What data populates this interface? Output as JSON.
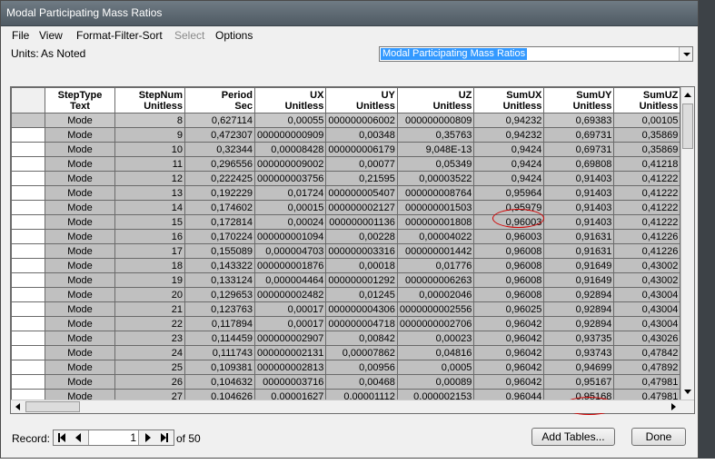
{
  "window": {
    "title": "Modal Participating Mass Ratios"
  },
  "menu": {
    "file": "File",
    "view": "View",
    "format": "Format-Filter-Sort",
    "select": "Select",
    "options": "Options"
  },
  "units": {
    "label": "Units:",
    "value": "As Noted"
  },
  "table_select": {
    "value": "Modal Participating Mass Ratios"
  },
  "grid": {
    "headers": [
      [
        "StepType",
        "Text"
      ],
      [
        "StepNum",
        "Unitless"
      ],
      [
        "Period",
        "Sec"
      ],
      [
        "UX",
        "Unitless"
      ],
      [
        "UY",
        "Unitless"
      ],
      [
        "UZ",
        "Unitless"
      ],
      [
        "SumUX",
        "Unitless"
      ],
      [
        "SumUY",
        "Unitless"
      ],
      [
        "SumUZ",
        "Unitless"
      ]
    ],
    "rows": [
      [
        "Mode",
        "8",
        "0,627114",
        "0,00055",
        "000000006002",
        "000000000809",
        "0,94232",
        "0,69383",
        "0,00105"
      ],
      [
        "Mode",
        "9",
        "0,472307",
        "000000000909",
        "0,00348",
        "0,35763",
        "0,94232",
        "0,69731",
        "0,35869"
      ],
      [
        "Mode",
        "10",
        "0,32344",
        "0,00008428",
        "000000006179",
        "9,048E-13",
        "0,9424",
        "0,69731",
        "0,35869"
      ],
      [
        "Mode",
        "11",
        "0,296556",
        "000000009002",
        "0,00077",
        "0,05349",
        "0,9424",
        "0,69808",
        "0,41218"
      ],
      [
        "Mode",
        "12",
        "0,222425",
        "000000003756",
        "0,21595",
        "0,00003522",
        "0,9424",
        "0,91403",
        "0,41222"
      ],
      [
        "Mode",
        "13",
        "0,192229",
        "0,01724",
        "000000005407",
        "000000008764",
        "0,95964",
        "0,91403",
        "0,41222"
      ],
      [
        "Mode",
        "14",
        "0,174602",
        "0,00015",
        "000000002127",
        "000000001503",
        "0,95979",
        "0,91403",
        "0,41222"
      ],
      [
        "Mode",
        "15",
        "0,172814",
        "0,00024",
        "000000001136",
        "000000001808",
        "0,96003",
        "0,91403",
        "0,41222"
      ],
      [
        "Mode",
        "16",
        "0,170224",
        "000000001094",
        "0,00228",
        "0,00004022",
        "0,96003",
        "0,91631",
        "0,41226"
      ],
      [
        "Mode",
        "17",
        "0,155089",
        "0,000004703",
        "000000003316",
        "000000001442",
        "0,96008",
        "0,91631",
        "0,41226"
      ],
      [
        "Mode",
        "18",
        "0,143322",
        "000000001876",
        "0,00018",
        "0,01776",
        "0,96008",
        "0,91649",
        "0,43002"
      ],
      [
        "Mode",
        "19",
        "0,133124",
        "0,000004464",
        "000000001292",
        "000000006263",
        "0,96008",
        "0,91649",
        "0,43002"
      ],
      [
        "Mode",
        "20",
        "0,129653",
        "000000002482",
        "0,01245",
        "0,00002046",
        "0,96008",
        "0,92894",
        "0,43004"
      ],
      [
        "Mode",
        "21",
        "0,123763",
        "0,00017",
        "000000004306",
        "0000000002556",
        "0,96025",
        "0,92894",
        "0,43004"
      ],
      [
        "Mode",
        "22",
        "0,117894",
        "0,00017",
        "000000004718",
        "0000000002706",
        "0,96042",
        "0,92894",
        "0,43004"
      ],
      [
        "Mode",
        "23",
        "0,114459",
        "000000002907",
        "0,00842",
        "0,00023",
        "0,96042",
        "0,93735",
        "0,43026"
      ],
      [
        "Mode",
        "24",
        "0,111743",
        "000000002131",
        "0,00007862",
        "0,04816",
        "0,96042",
        "0,93743",
        "0,47842"
      ],
      [
        "Mode",
        "25",
        "0,109381",
        "000000002813",
        "0,00956",
        "0,0005",
        "0,96042",
        "0,94699",
        "0,47892"
      ],
      [
        "Mode",
        "26",
        "0,104632",
        "00000003716",
        "0,00468",
        "0,00089",
        "0,96042",
        "0,95167",
        "0,47981"
      ],
      [
        "Mode",
        "27",
        "0,104626",
        "0,00001627",
        "0,00001112",
        "0,000002153",
        "0,96044",
        "0,95168",
        "0,47981"
      ]
    ]
  },
  "record": {
    "label": "Record:",
    "value": "1",
    "of_text": "of 50"
  },
  "buttons": {
    "add_tables": "Add Tables...",
    "done": "Done"
  }
}
